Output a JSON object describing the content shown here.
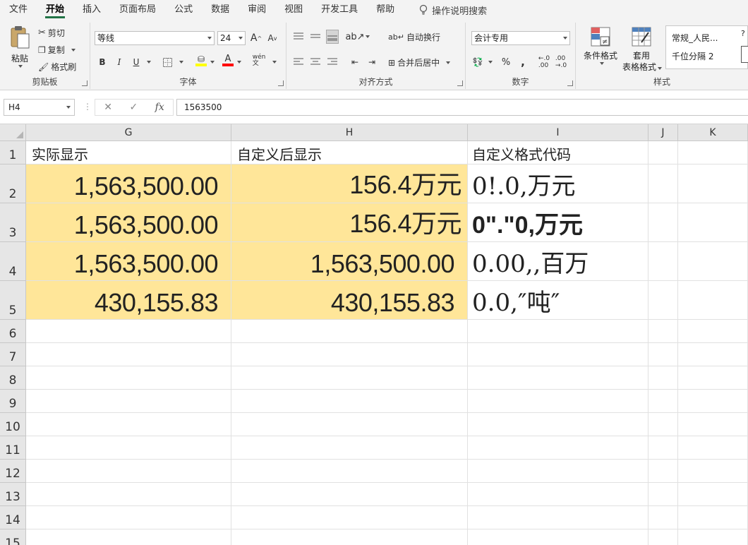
{
  "menu": {
    "items": [
      "文件",
      "开始",
      "插入",
      "页面布局",
      "公式",
      "数据",
      "审阅",
      "视图",
      "开发工具",
      "帮助"
    ],
    "active_index": 1,
    "tell_me": "操作说明搜索"
  },
  "ribbon": {
    "clipboard": {
      "paste": "粘贴",
      "cut": "剪切",
      "copy": "复制",
      "format_painter": "格式刷",
      "label": "剪贴板"
    },
    "font": {
      "name": "等线",
      "size": "24",
      "grow": "A",
      "shrink": "A",
      "bold": "B",
      "italic": "I",
      "underline": "U",
      "label": "字体",
      "fill_color": "#ffff00",
      "font_color": "#ff0000"
    },
    "alignment": {
      "wrap": "自动换行",
      "merge": "合并后居中",
      "label": "对齐方式"
    },
    "number": {
      "format": "会计专用",
      "percent": "%",
      "comma": ",",
      "label": "数字"
    },
    "styles": {
      "conditional": "条件格式",
      "table_line1": "套用",
      "table_line2": "表格格式",
      "style1": "常规_人民...",
      "style2": "千位分隔 2",
      "label": "样式"
    }
  },
  "formula_bar": {
    "name_box": "H4",
    "fx": "fx",
    "value": "1563500"
  },
  "grid": {
    "columns": [
      "G",
      "H",
      "I",
      "J",
      "K"
    ],
    "rows": [
      "1",
      "2",
      "3",
      "4",
      "5",
      "6",
      "7",
      "8",
      "9",
      "10",
      "11",
      "12",
      "13",
      "14",
      "15"
    ],
    "header_row": {
      "g": "实际显示",
      "h": "自定义后显示",
      "i": "自定义格式代码"
    },
    "data_rows": [
      {
        "g": "1,563,500.00",
        "h": "156.4万元",
        "i": "0!.0,万元"
      },
      {
        "g": "1,563,500.00",
        "h": "156.4万元",
        "i": "0\".\"0,万元"
      },
      {
        "g": "1,563,500.00",
        "h": "1,563,500.00",
        "i": "0.00,,百万"
      },
      {
        "g": "430,155.83",
        "h": "430,155.83",
        "i": "0.0,″吨″"
      }
    ],
    "highlight_color": "#ffe699"
  }
}
